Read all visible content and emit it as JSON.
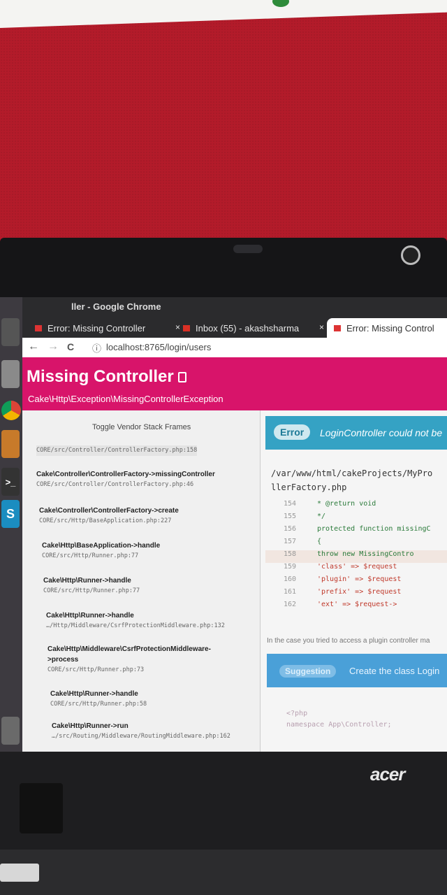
{
  "browser": {
    "window_title": "ller - Google Chrome",
    "tabs": [
      {
        "label": "Error: Missing Controller",
        "close": "×",
        "favicon": "cake-favicon",
        "active": false
      },
      {
        "label": "Inbox (55) - akashsharma",
        "close": "×",
        "favicon": "gmail-favicon",
        "active": false
      },
      {
        "label": "Error: Missing Control",
        "favicon": "cake-favicon",
        "active": true
      }
    ],
    "nav": {
      "back": "←",
      "forward": "→",
      "reload": "C"
    },
    "url": "localhost:8765/login/users",
    "info_icon": "ⓘ"
  },
  "launcher": {
    "items": [
      "terminal-icon",
      "files-icon",
      "chrome-icon",
      "sublime-icon",
      "terminal-icon",
      "software-center-icon",
      "trash-icon"
    ],
    "s_label": "S",
    "prompt_label": ">_"
  },
  "error_page": {
    "title": "Missing Controller",
    "exception": "Cake\\Http\\Exception\\MissingControllerException",
    "toggle_label": "Toggle Vendor Stack Frames",
    "frames": [
      {
        "method": "",
        "path": "CORE/src/Controller/ControllerFactory.php:158"
      },
      {
        "method": "Cake\\Controller\\ControllerFactory->missingController",
        "path": "CORE/src/Controller/ControllerFactory.php:46"
      },
      {
        "method": "Cake\\Controller\\ControllerFactory->create",
        "path": "CORE/src/Http/BaseApplication.php:227"
      },
      {
        "method": "Cake\\Http\\BaseApplication->handle",
        "path": "CORE/src/Http/Runner.php:77"
      },
      {
        "method": "Cake\\Http\\Runner->handle",
        "path": "CORE/src/Http/Runner.php:77"
      },
      {
        "method": "Cake\\Http\\Runner->handle",
        "path": "…/Http/Middleware/CsrfProtectionMiddleware.php:132"
      },
      {
        "method": "Cake\\Http\\Middleware\\CsrfProtectionMiddleware->process",
        "path": "CORE/src/Http/Runner.php:73"
      },
      {
        "method": "Cake\\Http\\Runner->handle",
        "path": "CORE/src/Http/Runner.php:58"
      },
      {
        "method": "Cake\\Http\\Runner->run",
        "path": "…/src/Routing/Middleware/RoutingMiddleware.php:162"
      }
    ],
    "error_badge": "Error",
    "error_message": "LoginController could not be",
    "file_path_1": "/var/www/html/cakeProjects/MyPro",
    "file_path_2": "llerFactory.php",
    "code_lines": [
      {
        "num": "154",
        "code": " * @return void"
      },
      {
        "num": "155",
        "code": " */"
      },
      {
        "num": "156",
        "code": "protected function missingC"
      },
      {
        "num": "157",
        "code": "{"
      },
      {
        "num": "158",
        "code": "    throw new MissingContro"
      },
      {
        "num": "159",
        "code": "        'class' => $request"
      },
      {
        "num": "160",
        "code": "        'plugin' => $request"
      },
      {
        "num": "161",
        "code": "        'prefix' => $request"
      },
      {
        "num": "162",
        "code": "        'ext' => $request->"
      }
    ],
    "plugin_hint": "In the case you tried to access a plugin controller ma",
    "suggestion_badge": "Suggestion",
    "suggestion_text": "Create the class Login",
    "php_open": "<?php",
    "php_namespace": "namespace App\\Controller;"
  },
  "laptop": {
    "brand": "acer"
  }
}
